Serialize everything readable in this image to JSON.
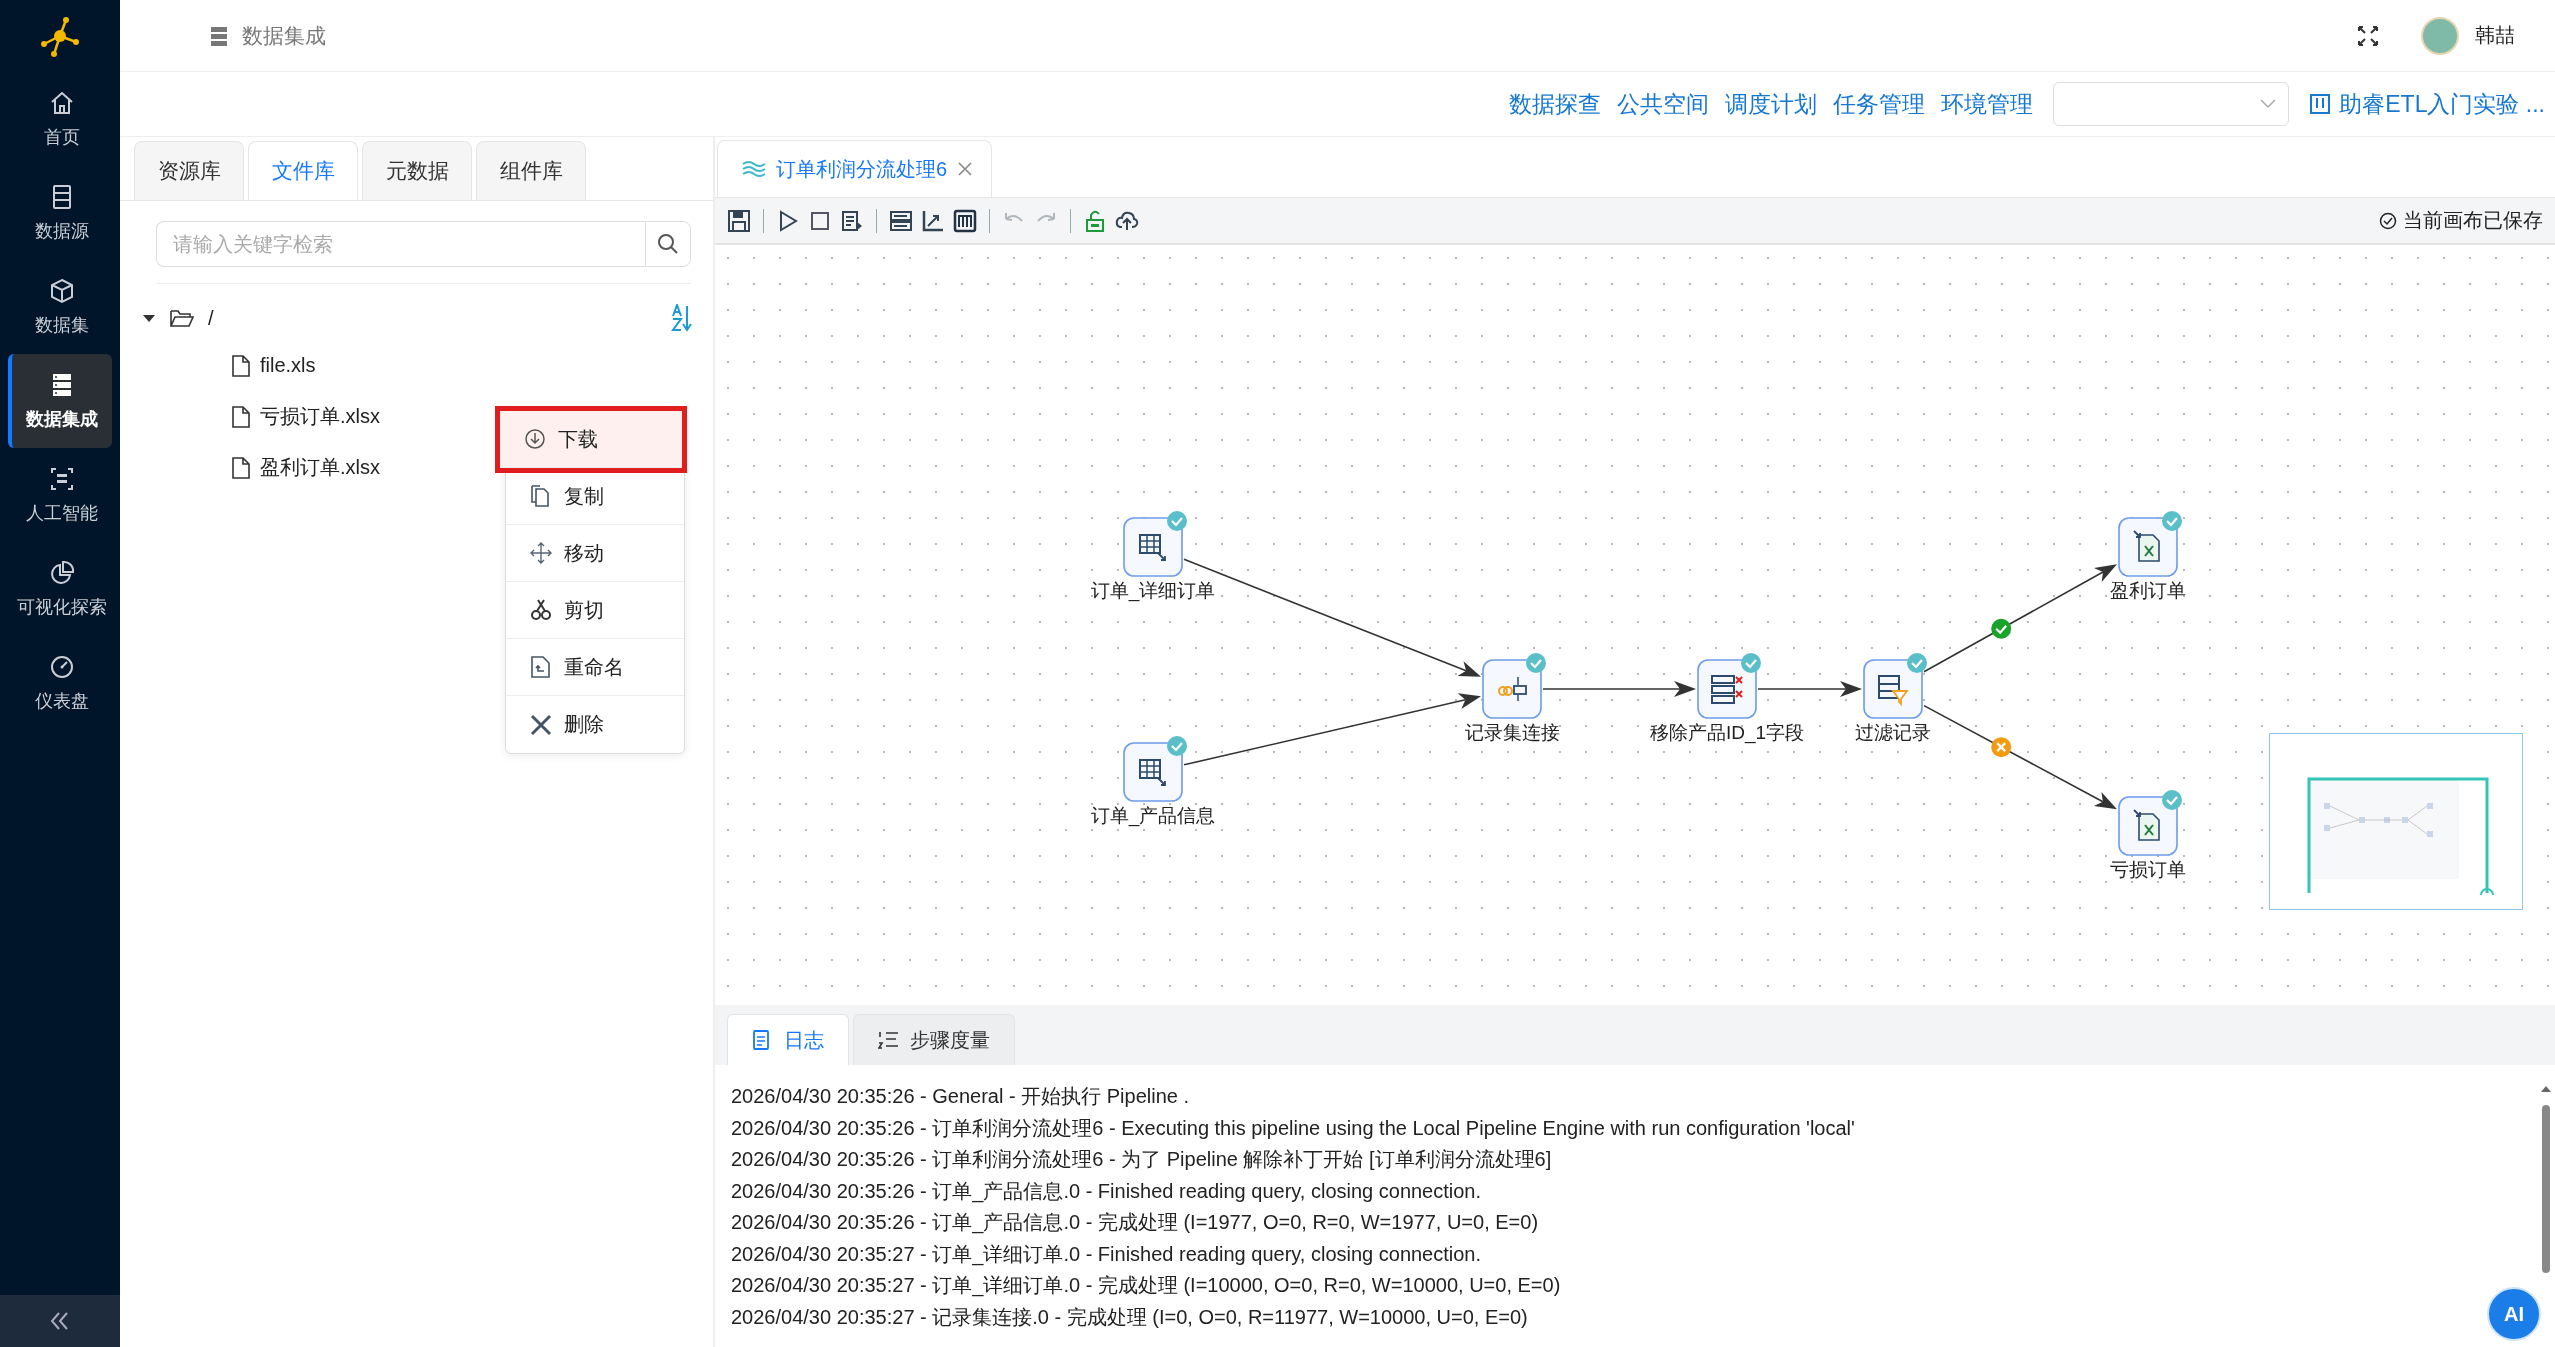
{
  "sidebar": {
    "items": [
      {
        "label": "首页",
        "kind": "home",
        "selected": false
      },
      {
        "label": "数据源",
        "kind": "datasource",
        "selected": false
      },
      {
        "label": "数据集",
        "kind": "dataset",
        "selected": false
      },
      {
        "label": "数据集成",
        "kind": "integration",
        "selected": true
      },
      {
        "label": "人工智能",
        "kind": "ai",
        "selected": false
      },
      {
        "label": "可视化探索",
        "kind": "chart",
        "selected": false
      },
      {
        "label": "仪表盘",
        "kind": "dashboard",
        "selected": false
      }
    ]
  },
  "header": {
    "breadcrumb": "数据集成",
    "user": "韩喆"
  },
  "nav": {
    "links": [
      "数据探查",
      "公共空间",
      "调度计划",
      "任务管理",
      "环境管理"
    ],
    "guide_link": "助睿ETL入门实验 ..."
  },
  "left_panel": {
    "tabs": [
      {
        "label": "资源库",
        "selected": false
      },
      {
        "label": "文件库",
        "selected": true
      },
      {
        "label": "元数据",
        "selected": false
      },
      {
        "label": "组件库",
        "selected": false
      }
    ],
    "search": {
      "placeholder": "请输入关键字检索"
    },
    "tree": [
      {
        "label": "/",
        "expanded": true,
        "children": [
          {
            "label": "file.xls"
          },
          {
            "label": "亏损订单.xlsx"
          },
          {
            "label": "盈利订单.xlsx"
          }
        ]
      }
    ]
  },
  "context_menu": {
    "items": [
      {
        "label": "下载",
        "kind": "download",
        "highlighted": true
      },
      {
        "label": "复制",
        "kind": "copy",
        "highlighted": false
      },
      {
        "label": "移动",
        "kind": "move",
        "highlighted": false
      },
      {
        "label": "剪切",
        "kind": "cut",
        "highlighted": false
      },
      {
        "label": "重命名",
        "kind": "rename",
        "highlighted": false
      },
      {
        "label": "删除",
        "kind": "delete",
        "highlighted": false
      }
    ]
  },
  "editor": {
    "tabs": [
      {
        "label": "订单利润分流处理6",
        "selected": true
      }
    ],
    "toolbar": [
      {
        "kind": "save",
        "disabled": false
      },
      {
        "kind": "separator"
      },
      {
        "kind": "run",
        "disabled": false
      },
      {
        "kind": "stop",
        "disabled": false
      },
      {
        "kind": "preview",
        "disabled": false
      },
      {
        "kind": "separator"
      },
      {
        "kind": "layout",
        "disabled": false
      },
      {
        "kind": "align",
        "disabled": false
      },
      {
        "kind": "metrics",
        "disabled": false
      },
      {
        "kind": "separator"
      },
      {
        "kind": "undo",
        "disabled": true
      },
      {
        "kind": "redo",
        "disabled": true
      },
      {
        "kind": "separator"
      },
      {
        "kind": "unlock",
        "disabled": false
      },
      {
        "kind": "upload",
        "disabled": false
      }
    ],
    "save_status": "当前画布已保存",
    "nodes": [
      {
        "label": "订单_详细订单",
        "kind": "table-input",
        "done": true
      },
      {
        "label": "订单_产品信息",
        "kind": "table-input",
        "done": true
      },
      {
        "label": "记录集连接",
        "kind": "join",
        "done": true
      },
      {
        "label": "移除产品ID_1字段",
        "kind": "remove-fields",
        "done": true
      },
      {
        "label": "过滤记录",
        "kind": "filter",
        "done": true
      },
      {
        "label": "盈利订单",
        "kind": "excel-output",
        "done": true
      },
      {
        "label": "亏损订单",
        "kind": "excel-output",
        "done": true
      }
    ],
    "edges": [
      {
        "kind": "normal"
      },
      {
        "kind": "normal"
      },
      {
        "kind": "normal"
      },
      {
        "kind": "normal"
      },
      {
        "kind": "success"
      },
      {
        "kind": "error"
      }
    ]
  },
  "bottom_panel": {
    "tabs": [
      {
        "label": "日志",
        "kind": "log",
        "selected": true
      },
      {
        "label": "步骤度量",
        "kind": "metrics",
        "selected": false
      }
    ],
    "log_lines": [
      "2026/04/30 20:35:26 - General - 开始执行 Pipeline .",
      "2026/04/30 20:35:26 - 订单利润分流处理6 - Executing this pipeline using the Local Pipeline Engine with run configuration 'local'",
      "2026/04/30 20:35:26 - 订单利润分流处理6 - 为了 Pipeline 解除补丁开始 [订单利润分流处理6]",
      "2026/04/30 20:35:26 - 订单_产品信息.0 - Finished reading query, closing connection.",
      "2026/04/30 20:35:26 - 订单_产品信息.0 - 完成处理 (I=1977, O=0, R=0, W=1977, U=0, E=0)",
      "2026/04/30 20:35:27 - 订单_详细订单.0 - Finished reading query, closing connection.",
      "2026/04/30 20:35:27 - 订单_详细订单.0 - 完成处理 (I=10000, O=0, R=0, W=10000, U=0, E=0)",
      "2026/04/30 20:35:27 - 记录集连接.0 - 完成处理 (I=0, O=0, R=11977, W=10000, U=0, E=0)"
    ]
  },
  "assistant_button": "AI"
}
